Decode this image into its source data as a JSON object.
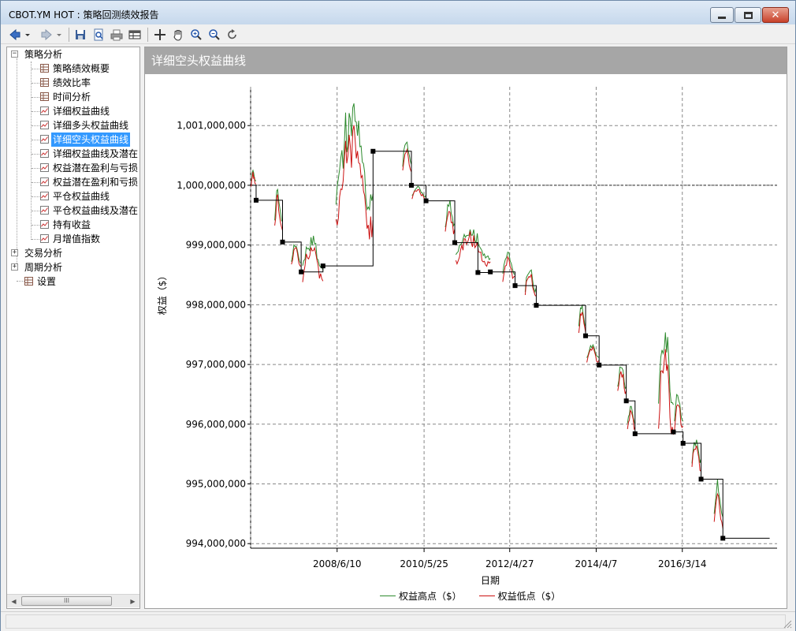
{
  "window": {
    "title": "CBOT.YM HOT : 策略回测绩效报告"
  },
  "toolbar": {
    "buttons": [
      {
        "icon": "back-arrow-icon"
      },
      {
        "icon": "dropdown-icon"
      },
      {
        "icon": "forward-arrow-icon"
      },
      {
        "icon": "dropdown-icon"
      },
      {
        "icon": "save-icon"
      },
      {
        "icon": "print-preview-icon"
      },
      {
        "icon": "print-icon"
      },
      {
        "icon": "table-icon"
      },
      {
        "icon": "crosshair-icon"
      },
      {
        "icon": "pan-hand-icon"
      },
      {
        "icon": "zoom-in-icon"
      },
      {
        "icon": "zoom-out-icon"
      },
      {
        "icon": "reset-view-icon"
      }
    ]
  },
  "tree": {
    "root": {
      "label": "策略分析",
      "expanded": true
    },
    "children": [
      {
        "label": "策略绩效概要",
        "icon": "table-icon"
      },
      {
        "label": "绩效比率",
        "icon": "table-icon"
      },
      {
        "label": "时间分析",
        "icon": "table-icon"
      },
      {
        "label": "详细权益曲线",
        "icon": "chart-icon"
      },
      {
        "label": "详细多头权益曲线",
        "icon": "chart-icon"
      },
      {
        "label": "详细空头权益曲线",
        "icon": "chart-icon",
        "selected": true
      },
      {
        "label": "详细权益曲线及潜在",
        "icon": "chart-icon"
      },
      {
        "label": "权益潜在盈利与亏损",
        "icon": "chart-icon"
      },
      {
        "label": "权益潜在盈利和亏损",
        "icon": "chart-icon"
      },
      {
        "label": "平仓权益曲线",
        "icon": "chart-icon"
      },
      {
        "label": "平仓权益曲线及潜在",
        "icon": "chart-icon"
      },
      {
        "label": "持有收益",
        "icon": "chart-icon"
      },
      {
        "label": "月增值指数",
        "icon": "chart-icon"
      }
    ],
    "others": [
      {
        "label": "交易分析",
        "expanded": false
      },
      {
        "label": "周期分析",
        "expanded": false
      },
      {
        "label": "设置",
        "leaf": true
      }
    ],
    "scroll_thumb_glyph": "III"
  },
  "panel": {
    "title": "详细空头权益曲线"
  },
  "chart_data": {
    "type": "line",
    "title": "",
    "xlabel": "日期",
    "ylabel": "权益（$）",
    "x_ticks": [
      "2008/6/10",
      "2010/5/25",
      "2012/4/27",
      "2014/4/7",
      "2016/3/14"
    ],
    "y_ticks": [
      994000000,
      995000000,
      996000000,
      997000000,
      998000000,
      999000000,
      1000000000,
      1001000000
    ],
    "y_tick_labels": [
      "994,000,000",
      "995,000,000",
      "996,000,000",
      "997,000,000",
      "998,000,000",
      "999,000,000",
      "1,000,000,000",
      "1,001,000,000"
    ],
    "ylim": [
      993950000,
      1001650000
    ],
    "xlim": [
      "2006/7/1",
      "2018/5/1"
    ],
    "grid": true,
    "legend_position": "bottom",
    "series": [
      {
        "name": "权益高点（$）",
        "color": "#2e8b2e"
      },
      {
        "name": "权益低点（$）",
        "color": "#cc1111"
      }
    ],
    "equity_steps": [
      {
        "date": "2006/7/10",
        "value": 1000000000
      },
      {
        "date": "2006/8/15",
        "value": 999750000
      },
      {
        "date": "2007/3/20",
        "value": 999050000
      },
      {
        "date": "2007/8/20",
        "value": 998550000
      },
      {
        "date": "2008/2/15",
        "value": 998650000
      },
      {
        "date": "2009/4/1",
        "value": 1000570000
      },
      {
        "date": "2010/2/10",
        "value": 1000000000
      },
      {
        "date": "2010/6/10",
        "value": 999740000
      },
      {
        "date": "2011/2/1",
        "value": 999040000
      },
      {
        "date": "2011/8/10",
        "value": 998540000
      },
      {
        "date": "2011/11/20",
        "value": 998550000
      },
      {
        "date": "2012/6/10",
        "value": 998320000
      },
      {
        "date": "2012/12/1",
        "value": 997990000
      },
      {
        "date": "2014/1/10",
        "value": 997480000
      },
      {
        "date": "2014/5/1",
        "value": 996990000
      },
      {
        "date": "2014/12/10",
        "value": 996390000
      },
      {
        "date": "2015/2/20",
        "value": 995840000
      },
      {
        "date": "2016/1/1",
        "value": 995870000
      },
      {
        "date": "2016/3/20",
        "value": 995680000
      },
      {
        "date": "2016/8/15",
        "value": 995080000
      },
      {
        "date": "2017/2/10",
        "value": 994090000
      },
      {
        "date": "2018/3/1",
        "value": 994090000
      }
    ],
    "segments_high_low": [
      {
        "start": "2006/7/5",
        "end": "2006/8/15",
        "peak": 1000260000,
        "trough": 999920000
      },
      {
        "start": "2007/1/15",
        "end": "2007/3/20",
        "peak": 999930000,
        "trough": 999050000
      },
      {
        "start": "2007/6/1",
        "end": "2007/8/20",
        "peak": 999060000,
        "trough": 998480000
      },
      {
        "start": "2007/9/1",
        "end": "2008/2/15",
        "peak": 999180000,
        "trough": 998210000
      },
      {
        "start": "2008/6/1",
        "end": "2009/4/1",
        "peak": 1001370000,
        "trough": 998610000
      },
      {
        "start": "2009/12/1",
        "end": "2010/2/10",
        "peak": 1000880000,
        "trough": 1000000000
      },
      {
        "start": "2010/2/15",
        "end": "2010/6/10",
        "peak": 1000000000,
        "trough": 999700000
      },
      {
        "start": "2010/11/15",
        "end": "2011/2/1",
        "peak": 999750000,
        "trough": 999030000
      },
      {
        "start": "2011/2/10",
        "end": "2011/11/20",
        "peak": 999260000,
        "trough": 998480000
      },
      {
        "start": "2012/3/1",
        "end": "2012/6/10",
        "peak": 998880000,
        "trough": 998280000
      },
      {
        "start": "2012/9/1",
        "end": "2012/12/1",
        "peak": 998680000,
        "trough": 997960000
      },
      {
        "start": "2013/11/15",
        "end": "2014/1/10",
        "peak": 997990000,
        "trough": 997430000
      },
      {
        "start": "2014/1/20",
        "end": "2014/5/1",
        "peak": 997330000,
        "trough": 996970000
      },
      {
        "start": "2014/10/1",
        "end": "2014/12/10",
        "peak": 996980000,
        "trough": 996370000
      },
      {
        "start": "2014/12/20",
        "end": "2015/2/20",
        "peak": 996310000,
        "trough": 995830000
      },
      {
        "start": "2015/9/1",
        "end": "2016/1/1",
        "peak": 997620000,
        "trough": 995450000
      },
      {
        "start": "2016/1/10",
        "end": "2016/3/20",
        "peak": 996600000,
        "trough": 995660000
      },
      {
        "start": "2016/6/1",
        "end": "2016/8/15",
        "peak": 995830000,
        "trough": 995080000
      },
      {
        "start": "2016/12/1",
        "end": "2017/2/10",
        "peak": 995080000,
        "trough": 994040000
      }
    ]
  }
}
